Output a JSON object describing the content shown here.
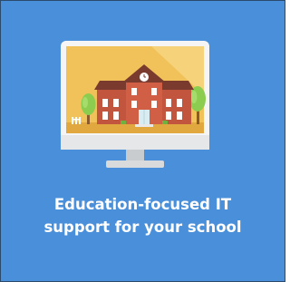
{
  "card": {
    "illustration": "school-building-on-monitor",
    "caption_line1": "Education-focused IT",
    "caption_line2": "support for your school"
  },
  "colors": {
    "card_background": "#4a8fd9",
    "card_border": "#2c4a6b",
    "monitor_frame": "#f5f5f5",
    "screen_background": "#f2c25a",
    "building_brick": "#c2553d",
    "roof": "#7b3a2e",
    "tree_green": "#8ccd4f",
    "caption_text": "#ffffff"
  }
}
